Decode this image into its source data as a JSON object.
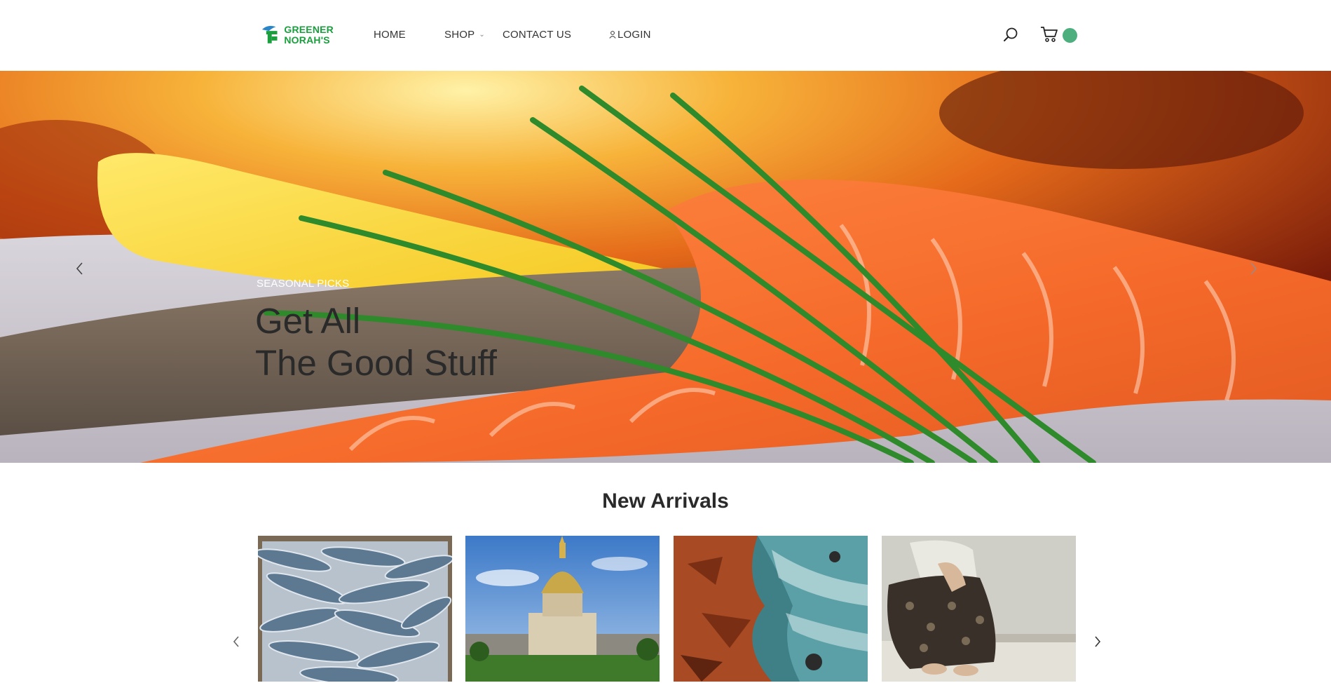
{
  "brand": {
    "line1": "GREENER",
    "line2": "NORAH'S",
    "color": "#1a9e3e"
  },
  "nav": {
    "home": "HOME",
    "shop": "SHOP",
    "contact": "CONTACT US",
    "login": "LOGIN"
  },
  "header_icons": {
    "search": "search-icon",
    "cart": "cart-icon",
    "cart_badge_color": "#4caf7d"
  },
  "hero": {
    "subtitle": "SEASONAL PICKS",
    "title_line1": "Get All",
    "title_line2": "The Good Stuff",
    "prev": "chevron-left-icon",
    "next": "chevron-right-icon"
  },
  "new_arrivals": {
    "title": "New Arrivals",
    "prev": "chevron-left-icon",
    "next": "chevron-right-icon"
  }
}
